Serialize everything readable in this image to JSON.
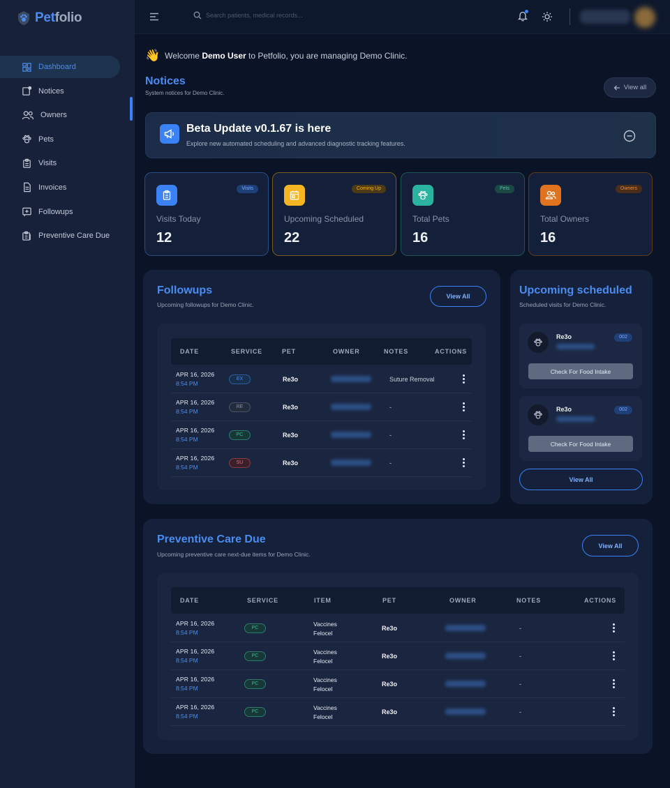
{
  "app": {
    "logo_pet": "Pet",
    "logo_folio": "folio"
  },
  "sidebar": {
    "items": [
      {
        "label": "Dashboard",
        "icon": "dashboard-icon"
      },
      {
        "label": "Notices",
        "icon": "notice-icon"
      },
      {
        "label": "Owners",
        "icon": "users-icon"
      },
      {
        "label": "Pets",
        "icon": "paw-icon"
      },
      {
        "label": "Visits",
        "icon": "clipboard-icon"
      },
      {
        "label": "Invoices",
        "icon": "invoice-icon"
      },
      {
        "label": "Followups",
        "icon": "followup-icon"
      },
      {
        "label": "Preventive Care Due",
        "icon": "preventive-icon"
      }
    ]
  },
  "topbar": {
    "search_placeholder": "Search patients, medical records..."
  },
  "welcome": {
    "prefix": "Welcome",
    "user": "Demo User",
    "suffix": "to Petfolio, you are managing Demo Clinic."
  },
  "notices": {
    "title": "Notices",
    "subtitle": "System notices for Demo Clinic.",
    "view_all": "View all"
  },
  "beta": {
    "title": "Beta Update v0.1.67 is here",
    "subtitle": "Explore new automated scheduling and advanced diagnostic tracking features."
  },
  "stats": [
    {
      "badge": "Visits",
      "label": "Visits Today",
      "value": "12",
      "color": "#3b82f6"
    },
    {
      "badge": "Coming Up",
      "label": "Upcoming Scheduled",
      "value": "22",
      "color": "#f5b522"
    },
    {
      "badge": "Pets",
      "label": "Total Pets",
      "value": "16",
      "color": "#2bb3a0"
    },
    {
      "badge": "Owners",
      "label": "Total Owners",
      "value": "16",
      "color": "#e0731f"
    }
  ],
  "followups": {
    "title": "Followups",
    "subtitle": "Upcoming followups for Demo Clinic.",
    "view_all": "View All",
    "columns": [
      "DATE",
      "SERVICE",
      "PET",
      "OWNER",
      "NOTES",
      "ACTIONS"
    ],
    "rows": [
      {
        "date": "APR 16, 2026",
        "time": "8:54 PM",
        "service": "EX",
        "pet": "Re3o",
        "notes": "Suture Removal"
      },
      {
        "date": "APR 16, 2026",
        "time": "8:54 PM",
        "service": "RE",
        "pet": "Re3o",
        "notes": "-"
      },
      {
        "date": "APR 16, 2026",
        "time": "8:54 PM",
        "service": "PC",
        "pet": "Re3o",
        "notes": "-"
      },
      {
        "date": "APR 16, 2026",
        "time": "8:54 PM",
        "service": "SU",
        "pet": "Re3o",
        "notes": "-"
      }
    ]
  },
  "upcoming": {
    "title": "Upcoming scheduled",
    "subtitle": "Scheduled visits for Demo Clinic.",
    "view_all": "View All",
    "visits": [
      {
        "pet": "Re3o",
        "badge": "002",
        "action": "Check For Food Intake"
      },
      {
        "pet": "Re3o",
        "badge": "002",
        "action": "Check For Food Intake"
      }
    ]
  },
  "preventive": {
    "title": "Preventive Care Due",
    "subtitle": "Upcoming preventive care next-due items for Demo Clinic.",
    "view_all": "View All",
    "columns": [
      "DATE",
      "SERVICE",
      "ITEM",
      "PET",
      "OWNER",
      "NOTES",
      "ACTIONS"
    ],
    "rows": [
      {
        "date": "APR 16, 2026",
        "time": "8:54 PM",
        "service": "PC",
        "item1": "Vaccines",
        "item2": "Felocel",
        "pet": "Re3o",
        "notes": "-"
      },
      {
        "date": "APR 16, 2026",
        "time": "8:54 PM",
        "service": "PC",
        "item1": "Vaccines",
        "item2": "Felocel",
        "pet": "Re3o",
        "notes": "-"
      },
      {
        "date": "APR 16, 2026",
        "time": "8:54 PM",
        "service": "PC",
        "item1": "Vaccines",
        "item2": "Felocel",
        "pet": "Re3o",
        "notes": "-"
      },
      {
        "date": "APR 16, 2026",
        "time": "8:54 PM",
        "service": "PC",
        "item1": "Vaccines",
        "item2": "Felocel",
        "pet": "Re3o",
        "notes": "-"
      }
    ]
  }
}
